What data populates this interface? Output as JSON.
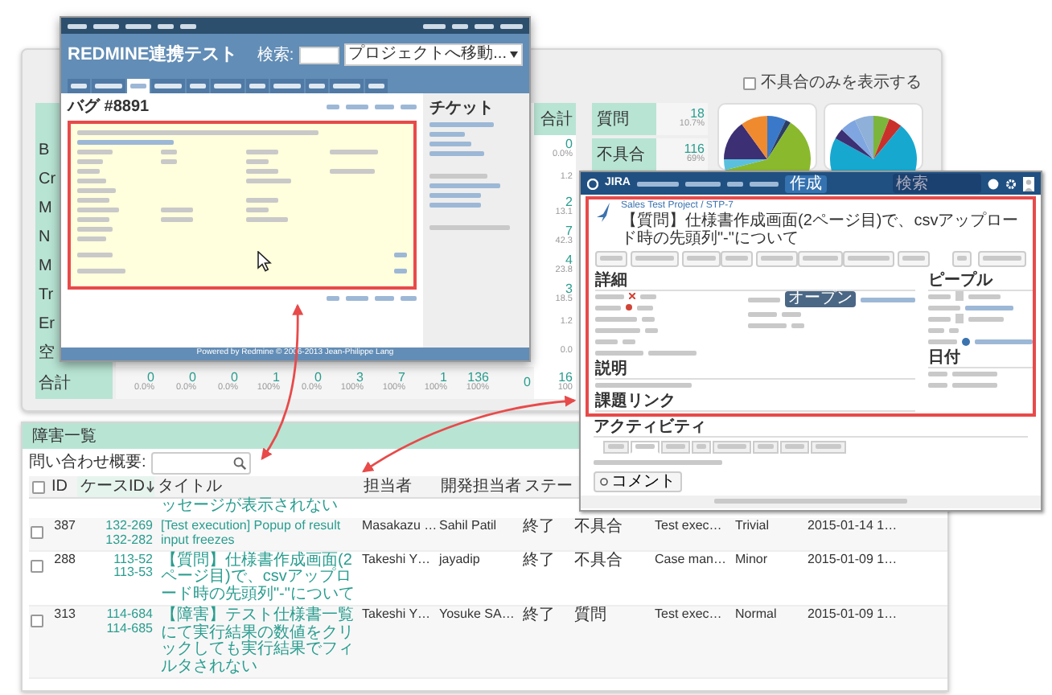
{
  "redmine_window": {
    "title": "REDMINE連携テスト",
    "search_label": "検索:",
    "project_jump": "プロジェクトへ移動...",
    "tabs": [
      {
        "selected": false
      },
      {
        "selected": false
      },
      {
        "selected": true
      },
      {
        "selected": false
      },
      {
        "selected": false
      },
      {
        "selected": false
      },
      {
        "selected": false
      },
      {
        "selected": false
      },
      {
        "selected": false
      },
      {
        "selected": false
      },
      {
        "selected": false
      }
    ],
    "issue_heading": "バグ #8891",
    "sidebar_heading": "チケット",
    "footer": "Powered by Redmine © 2006-2013 Jean-Philippe Lang"
  },
  "stats_panel": {
    "filter_checkbox": {
      "label": "不具合のみを表示する",
      "checked": false
    },
    "row_labels": [
      "B",
      "Cr",
      "M",
      "N",
      "M",
      "Tr",
      "Er",
      "空"
    ],
    "total_row": {
      "label": "合計",
      "cells": [
        {
          "value": "0",
          "percent": "0.0%"
        },
        {
          "value": "0",
          "percent": "0.0%"
        },
        {
          "value": "0",
          "percent": "0.0%"
        },
        {
          "value": "1",
          "percent": "100%"
        },
        {
          "value": "0",
          "percent": "0.0%"
        },
        {
          "value": "3",
          "percent": "100%"
        },
        {
          "value": "7",
          "percent": "100%"
        },
        {
          "value": "1",
          "percent": "100%"
        },
        {
          "value": "136",
          "percent": "100%"
        },
        {
          "value": "0"
        }
      ]
    },
    "total_column": {
      "header": "合計",
      "cells": [
        {
          "value": "0",
          "percent": "0.0%"
        },
        {
          "percent": "1.2"
        },
        {
          "value": "2",
          "percent": "13.1"
        },
        {
          "value": "7",
          "percent": "42.3"
        },
        {
          "value": "4",
          "percent": "23.8"
        },
        {
          "value": "3",
          "percent": "18.5"
        },
        {
          "percent": "1.2"
        },
        {
          "percent": "0.0"
        },
        {
          "value": "16",
          "percent": "100"
        }
      ]
    },
    "type_table": [
      {
        "label": "質問",
        "count": "18",
        "percent": "10.7%"
      },
      {
        "label": "不具合",
        "count": "116",
        "percent": "69%"
      }
    ]
  },
  "jira_window": {
    "logo": "JIRA",
    "create_button": "作成",
    "search_placeholder": "検索",
    "breadcrumb": "Sales Test Project / STP-7",
    "title": "【質問】仕様書作成画面(2ページ目)で、csvアップロード時の先頭列\"-\"について",
    "details_heading": "詳細",
    "status_badge": "オープン",
    "description_heading": "説明",
    "links_heading": "課題リンク",
    "people_heading": "ピープル",
    "dates_heading": "日付",
    "activity_heading": "アクティビティ",
    "activity_tabs": [
      {
        "selected": false
      },
      {
        "selected": true
      },
      {
        "selected": false
      },
      {
        "selected": false
      },
      {
        "selected": false
      },
      {
        "selected": false
      },
      {
        "selected": false
      },
      {
        "selected": false
      }
    ],
    "comment_button": "コメント"
  },
  "issues_table": {
    "title": "障害一覧",
    "search_label": "問い合わせ概要:",
    "select_all_checked": false,
    "columns": [
      {
        "label": "ID",
        "sorted": false
      },
      {
        "label": "ケースID",
        "sorted": true
      },
      {
        "label": "タイトル",
        "sorted": false
      },
      {
        "label": "担当者",
        "sorted": false
      },
      {
        "label": "開発担当者",
        "sorted": false
      },
      {
        "label": "ステー",
        "sorted": false
      }
    ],
    "partial_row": {
      "title": "ッセージが表示されない"
    },
    "rows": [
      {
        "checked": false,
        "id": "387",
        "case_ids": [
          "132-269",
          "132-282"
        ],
        "title": "[Test execution] Popup of result input freezes",
        "assignee": "Masakazu …",
        "developer": "Sahil Patil",
        "status": "終了",
        "type": "不具合",
        "category": "Test exec…",
        "priority": "Trivial",
        "date": "2015-01-14 1…"
      },
      {
        "checked": false,
        "id": "288",
        "case_ids": [
          "113-52",
          "113-53"
        ],
        "title": "【質問】仕様書作成画面(2ページ目)で、csvアップロード時の先頭列\"-\"について",
        "assignee": "Takeshi Y…",
        "developer": "jayadip",
        "status": "終了",
        "type": "不具合",
        "category": "Case man…",
        "priority": "Minor",
        "date": "2015-01-09 1…"
      },
      {
        "checked": false,
        "id": "313",
        "case_ids": [
          "114-684",
          "114-685"
        ],
        "title": "【障害】テスト仕様書一覧にて実行結果の数値をクリックしても実行結果でフィルタされない",
        "assignee": "Takeshi Y…",
        "developer": "Yosuke SA…",
        "status": "終了",
        "type": "質問",
        "category": "Test exec…",
        "priority": "Normal",
        "date": "2015-01-09 1…"
      }
    ]
  }
}
